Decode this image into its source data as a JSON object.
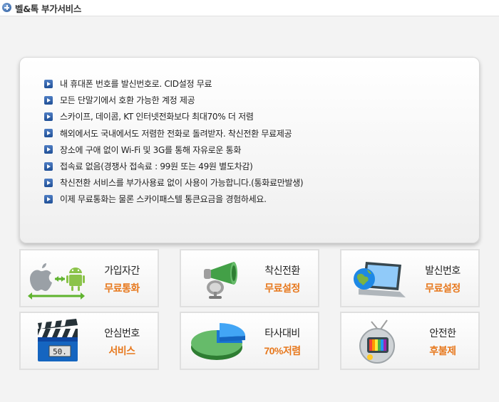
{
  "header": {
    "title": "벨&톡 부가서비스",
    "icon": "plus-circle-icon"
  },
  "features": [
    "내 휴대폰 번호를 발신번호로.  CID설정 무료",
    "모든 단말기에서 호환 가능한 계정 제공",
    "스카이프, 데이콤, KT 인터넷전화보다  최대70% 더 저렴",
    "해외에서도 국내에서도 저렴한 전화로 돌려받자. 착신전환 무료제공",
    "장소에 구애 없이 Wi-Fi 및 3G를 통해 자유로운 통화",
    "접속료 없음(경쟁사 접속료 : 99원 또는 49원 별도차감)",
    "착신전환 서비스를 부가사용료 없이 사용이 가능합니다.(통화료만발생)",
    "이제 무료통화는 물론 스카이패스텔 통큰요금을 경험하세요."
  ],
  "tiles": [
    {
      "line1": "가입자간",
      "line2": "무료통화",
      "icon": "apple-android-icon"
    },
    {
      "line1": "착신전환",
      "line2": "무료설정",
      "icon": "megaphone-icon"
    },
    {
      "line1": "발신번호",
      "line2": "무료설정",
      "icon": "laptop-globe-icon"
    },
    {
      "line1": "안심번호",
      "line2": "서비스",
      "icon": "clapperboard-icon",
      "icon_text": "50."
    },
    {
      "line1": "타사대비",
      "line2": "70%저렴",
      "icon": "pie-chart-icon"
    },
    {
      "line1": "안전한",
      "line2": "후불제",
      "icon": "tv-icon"
    }
  ],
  "colors": {
    "accent": "#e7781d",
    "bullet": "#2d5c9e"
  }
}
